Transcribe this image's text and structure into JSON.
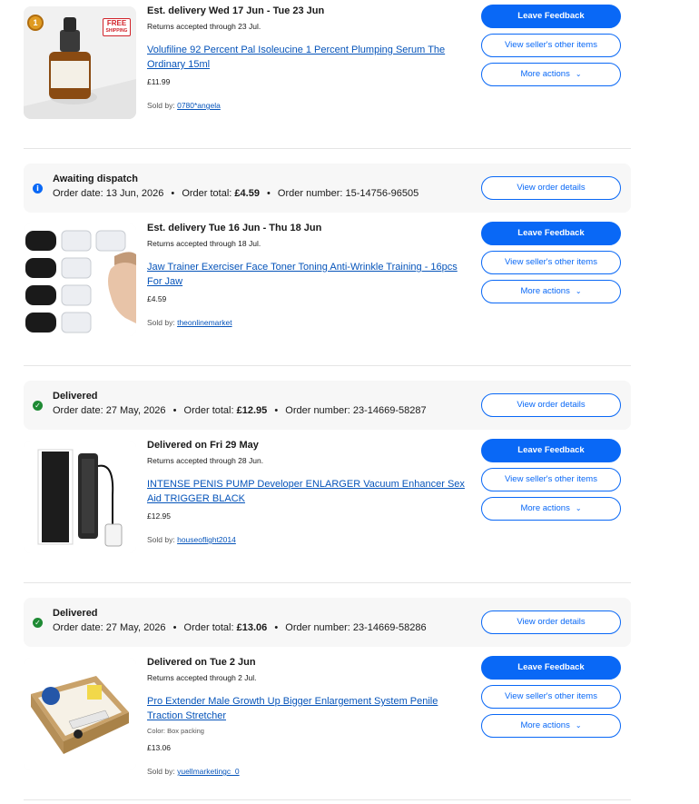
{
  "buttons": {
    "leave_feedback": "Leave Feedback",
    "view_seller_items": "View seller's other items",
    "more_actions": "More actions",
    "view_order_details": "View order details"
  },
  "sold_by_label": "Sold by:",
  "order_meta_labels": {
    "order_date": "Order date:",
    "order_total": "Order total:",
    "order_number": "Order number:"
  },
  "items": [
    {
      "delivery": "Est. delivery Wed 17 Jun - Tue 23 Jun",
      "returns": "Returns accepted through 23 Jul.",
      "title": "Volufiline 92 Percent Pal Isoleucine 1 Percent Plumping Serum The Ordinary 15ml",
      "price": "£11.99",
      "seller": "0780*angela",
      "badge_free": "FREE",
      "badge_shipping": "SHIPPING",
      "badge_rank": "1"
    },
    {
      "status": "Awaiting dispatch",
      "order_date": "13 Jun, 2026",
      "order_total": "£4.59",
      "order_number": "15-14756-96505",
      "delivery": "Est. delivery Tue 16 Jun - Thu 18 Jun",
      "returns": "Returns accepted through 18 Jul.",
      "title": "Jaw Trainer Exerciser Face Toner Toning Anti-Wrinkle Training - 16pcs For Jaw",
      "price": "£4.59",
      "seller": "theonlinemarket"
    },
    {
      "status": "Delivered",
      "order_date": "27 May, 2026",
      "order_total": "£12.95",
      "order_number": "23-14669-58287",
      "delivery": "Delivered on Fri 29 May",
      "returns": "Returns accepted through 28 Jun.",
      "title": "INTENSE PENIS PUMP Developer ENLARGER Vacuum Enhancer Sex Aid TRIGGER BLACK",
      "price": "£12.95",
      "seller": "houseoflight2014"
    },
    {
      "status": "Delivered",
      "order_date": "27 May, 2026",
      "order_total": "£13.06",
      "order_number": "23-14669-58286",
      "delivery": "Delivered on Tue 2 Jun",
      "returns": "Returns accepted through 2 Jul.",
      "title": "Pro Extender Male Growth Up Bigger Enlargement System Penile Traction Stretcher",
      "variant": "Color: Box packing",
      "price": "£13.06",
      "seller": "yuellmarketingc_0"
    }
  ],
  "colors": {
    "primary_blue": "#0968f6",
    "link_blue": "#0654ba",
    "success_green": "#1e8a34",
    "band_grey": "#f7f7f7"
  }
}
